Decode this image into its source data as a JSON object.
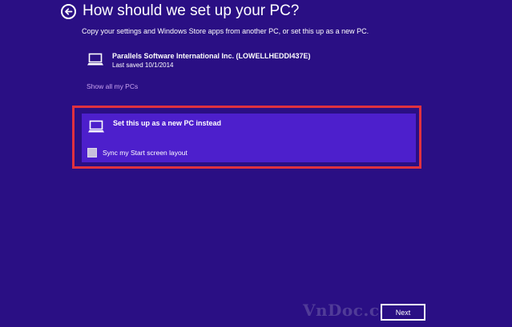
{
  "header": {
    "title": "How should we set up your PC?",
    "subtitle": "Copy your settings and Windows Store apps from another PC, or set this up as a new PC."
  },
  "existing_pc": {
    "name": "Parallels Software International Inc. (LOWELLHEDDI437E)",
    "last_saved": "Last saved 10/1/2014",
    "icon": "laptop-icon"
  },
  "show_all_link": "Show all my PCs",
  "new_pc_option": {
    "label": "Set this up as a new PC instead",
    "icon": "laptop-icon",
    "sync_checkbox_label": "Sync my Start screen layout",
    "sync_checked": false
  },
  "footer": {
    "next_label": "Next"
  },
  "watermark": {
    "text": "VnDoc.com"
  },
  "colors": {
    "background": "#2a0f84",
    "selected_tile": "#4d1fcc",
    "link": "#c8a2f0",
    "highlight_frame": "#e0313f"
  }
}
